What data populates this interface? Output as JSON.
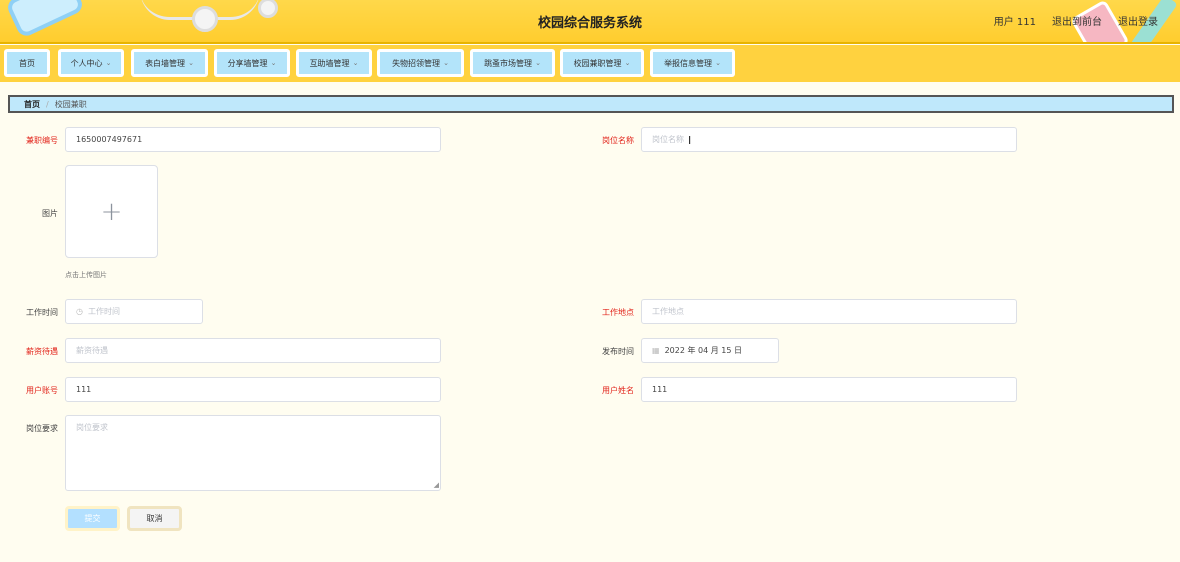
{
  "header": {
    "title": "校园综合服务系统",
    "user_label": "用户 111",
    "back_front": "退出到前台",
    "logout": "退出登录"
  },
  "nav": [
    {
      "label": "首页",
      "dropdown": false
    },
    {
      "label": "个人中心",
      "dropdown": true
    },
    {
      "label": "表白墙管理",
      "dropdown": true
    },
    {
      "label": "分享墙管理",
      "dropdown": true
    },
    {
      "label": "互助墙管理",
      "dropdown": true
    },
    {
      "label": "失物招领管理",
      "dropdown": true
    },
    {
      "label": "跳蚤市场管理",
      "dropdown": true
    },
    {
      "label": "校园兼职管理",
      "dropdown": true
    },
    {
      "label": "举报信息管理",
      "dropdown": true
    }
  ],
  "breadcrumb": {
    "home": "首页",
    "separator": "/",
    "current": "校园兼职"
  },
  "form": {
    "job_no_label": "兼职编号",
    "job_no_value": "1650007497671",
    "position_label": "岗位名称",
    "position_placeholder": "岗位名称",
    "image_label": "图片",
    "upload_plus": "+",
    "upload_tip": "点击上传图片",
    "work_time_label": "工作时间",
    "work_time_placeholder": "工作时间",
    "work_place_label": "工作地点",
    "work_place_placeholder": "工作地点",
    "salary_label": "薪资待遇",
    "salary_placeholder": "薪资待遇",
    "publish_time_label": "发布时间",
    "publish_time_value": "2022 年 04 月 15 日",
    "user_account_label": "用户账号",
    "user_account_value": "111",
    "user_name_label": "用户姓名",
    "user_name_value": "111",
    "requirement_label": "岗位要求",
    "requirement_placeholder": "岗位要求",
    "submit_label": "提交",
    "cancel_label": "取消"
  },
  "colors": {
    "header_bg": "#ffcd2e",
    "nav_item_bg": "#b3e4fa",
    "required_label": "#e2231a",
    "page_bg": "#fffdf0"
  }
}
